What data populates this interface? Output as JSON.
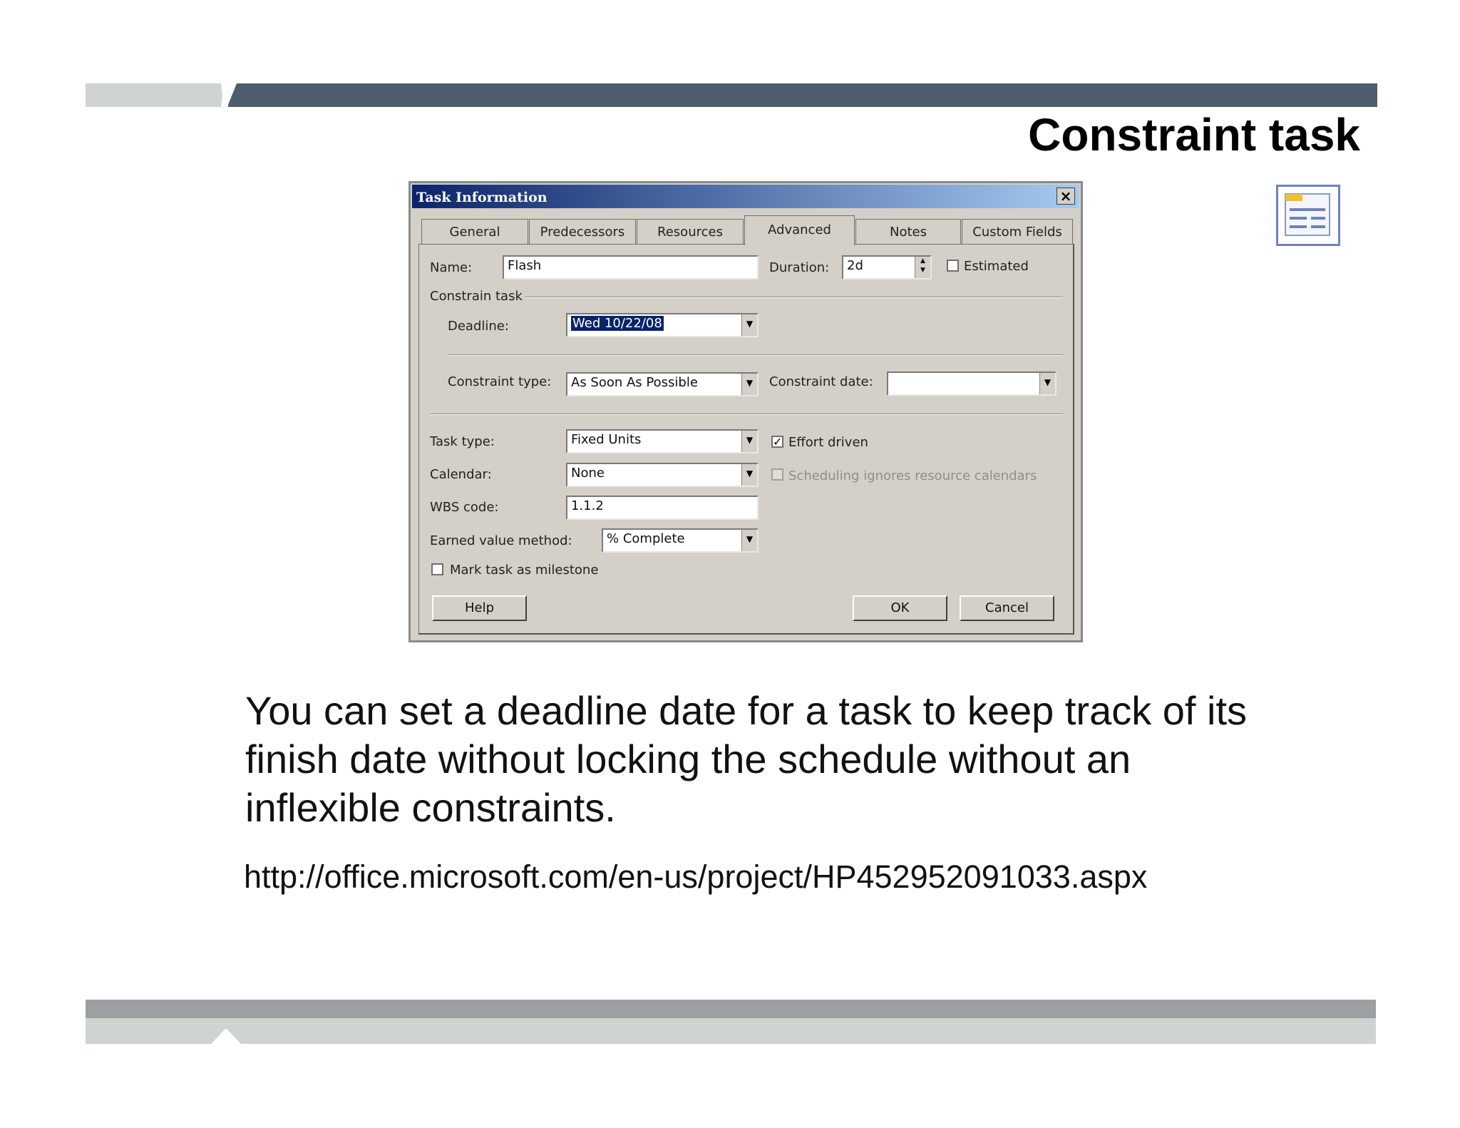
{
  "slide": {
    "title": "Constraint task",
    "body": "You can set a deadline date for a task to keep track of its finish date without locking the schedule without an inflexible constraints.",
    "link": "http://office.microsoft.com/en-us/project/HP452952091033.aspx",
    "icon": "outline-view-icon"
  },
  "dialog": {
    "title": "Task Information",
    "close_label": "×",
    "tabs": [
      {
        "label": "General"
      },
      {
        "label": "Predecessors"
      },
      {
        "label": "Resources"
      },
      {
        "label": "Advanced",
        "active": true
      },
      {
        "label": "Notes"
      },
      {
        "label": "Custom Fields"
      }
    ],
    "name_label": "Name:",
    "name_value": "Flash",
    "duration_label": "Duration:",
    "duration_value": "2d",
    "estimated_label": "Estimated",
    "estimated_checked": false,
    "constrain_group": "Constrain task",
    "deadline_label": "Deadline:",
    "deadline_value": "Wed 10/22/08",
    "constraint_type_label": "Constraint type:",
    "constraint_type_value": "As Soon As Possible",
    "constraint_date_label": "Constraint date:",
    "constraint_date_value": "",
    "task_type_label": "Task type:",
    "task_type_value": "Fixed Units",
    "effort_driven_label": "Effort driven",
    "effort_driven_checked": true,
    "calendar_label": "Calendar:",
    "calendar_value": "None",
    "sched_ignores_label": "Scheduling ignores resource calendars",
    "wbs_label": "WBS code:",
    "wbs_value": "1.1.2",
    "earned_label": "Earned value method:",
    "earned_value": "% Complete",
    "milestone_label": "Mark task as milestone",
    "help_label": "Help",
    "ok_label": "OK",
    "cancel_label": "Cancel",
    "check_mark": "✓",
    "dropdown_arrow": "▼",
    "spin_up": "▲",
    "spin_down": "▼"
  }
}
